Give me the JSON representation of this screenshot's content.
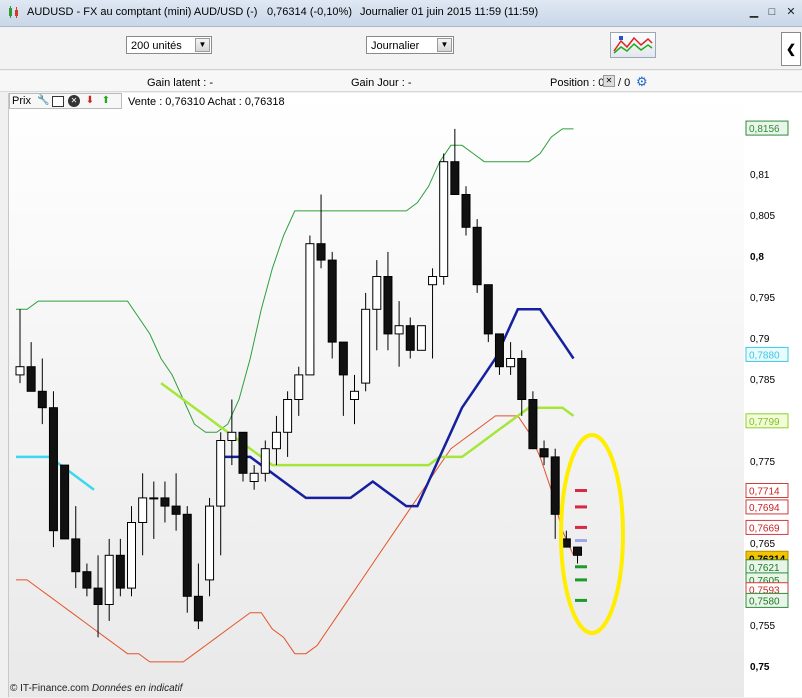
{
  "window": {
    "title": "AUDUSD - FX au comptant  (mini) AUD/USD (-)",
    "price_change": "0,76314 (-0,10%)",
    "period_info": "Journalier  01 juin 2015 11:59 (11:59)"
  },
  "toolbar": {
    "units_select": "200 unités",
    "period_select": "Journalier"
  },
  "infobar": {
    "gain_latent": "Gain latent : -",
    "gain_jour": "Gain Jour : -",
    "position_label": "Position : 0",
    "position_value": "/ 0"
  },
  "chart_toolbar": {
    "label": "Prix",
    "icons": [
      "wrench-icon",
      "window-icon",
      "close-icon",
      "down-arrow-icon",
      "up-arrow-icon"
    ]
  },
  "quote": "Vente : 0,76310 Achat : 0,76318",
  "footer": {
    "brand": "© IT-Finance.com",
    "note": "Données en indicatif"
  },
  "colors": {
    "upper_band": "#2e9e3e",
    "lower_band": "#e4532a",
    "ma_cyan": "#3bd8ee",
    "ma_navy": "#14209e",
    "ma_green": "#1d9e2a",
    "ma_lime": "#a6e63a",
    "highlight": "#ffee00",
    "last_price": "#f5c400"
  },
  "chart_data": {
    "type": "candlestick",
    "instrument": "AUDUSD",
    "y_ticks": [
      "0,81",
      "0,805",
      "0,8",
      "0,795",
      "0,79",
      "0,785",
      "0,775",
      "0,765",
      "0,755",
      "0,75"
    ],
    "ylim": [
      0.75,
      0.817
    ],
    "candles": [
      {
        "o": 0.7855,
        "h": 0.7935,
        "l": 0.7845,
        "c": 0.7865
      },
      {
        "o": 0.7865,
        "h": 0.7895,
        "l": 0.7835,
        "c": 0.7835
      },
      {
        "o": 0.7835,
        "h": 0.7875,
        "l": 0.7795,
        "c": 0.7815
      },
      {
        "o": 0.7815,
        "h": 0.7835,
        "l": 0.7645,
        "c": 0.7665
      },
      {
        "o": 0.7745,
        "h": 0.7745,
        "l": 0.7655,
        "c": 0.7655
      },
      {
        "o": 0.7655,
        "h": 0.7695,
        "l": 0.7595,
        "c": 0.7615
      },
      {
        "o": 0.7615,
        "h": 0.7625,
        "l": 0.7585,
        "c": 0.7595
      },
      {
        "o": 0.7595,
        "h": 0.7635,
        "l": 0.7535,
        "c": 0.7575
      },
      {
        "o": 0.7575,
        "h": 0.7655,
        "l": 0.7555,
        "c": 0.7635
      },
      {
        "o": 0.7635,
        "h": 0.7655,
        "l": 0.7585,
        "c": 0.7595
      },
      {
        "o": 0.7595,
        "h": 0.7695,
        "l": 0.7585,
        "c": 0.7675
      },
      {
        "o": 0.7675,
        "h": 0.7735,
        "l": 0.7635,
        "c": 0.7705
      },
      {
        "o": 0.7705,
        "h": 0.7725,
        "l": 0.7655,
        "c": 0.7705
      },
      {
        "o": 0.7705,
        "h": 0.7725,
        "l": 0.7675,
        "c": 0.7695
      },
      {
        "o": 0.7695,
        "h": 0.7735,
        "l": 0.7665,
        "c": 0.7685
      },
      {
        "o": 0.7685,
        "h": 0.7695,
        "l": 0.7565,
        "c": 0.7585
      },
      {
        "o": 0.7585,
        "h": 0.7625,
        "l": 0.7545,
        "c": 0.7555
      },
      {
        "o": 0.7605,
        "h": 0.7705,
        "l": 0.7585,
        "c": 0.7695
      },
      {
        "o": 0.7695,
        "h": 0.7785,
        "l": 0.7635,
        "c": 0.7775
      },
      {
        "o": 0.7775,
        "h": 0.7825,
        "l": 0.7745,
        "c": 0.7785
      },
      {
        "o": 0.7785,
        "h": 0.7785,
        "l": 0.7725,
        "c": 0.7735
      },
      {
        "o": 0.7725,
        "h": 0.7745,
        "l": 0.7715,
        "c": 0.7735
      },
      {
        "o": 0.7735,
        "h": 0.7775,
        "l": 0.7725,
        "c": 0.7765
      },
      {
        "o": 0.7765,
        "h": 0.7805,
        "l": 0.7745,
        "c": 0.7785
      },
      {
        "o": 0.7785,
        "h": 0.7835,
        "l": 0.7755,
        "c": 0.7825
      },
      {
        "o": 0.7825,
        "h": 0.7865,
        "l": 0.7805,
        "c": 0.7855
      },
      {
        "o": 0.7855,
        "h": 0.8025,
        "l": 0.7855,
        "c": 0.8015
      },
      {
        "o": 0.8015,
        "h": 0.8075,
        "l": 0.7985,
        "c": 0.7995
      },
      {
        "o": 0.7995,
        "h": 0.8005,
        "l": 0.7875,
        "c": 0.7895
      },
      {
        "o": 0.7895,
        "h": 0.7895,
        "l": 0.7805,
        "c": 0.7855
      },
      {
        "o": 0.7825,
        "h": 0.7855,
        "l": 0.7795,
        "c": 0.7835
      },
      {
        "o": 0.7845,
        "h": 0.7955,
        "l": 0.7835,
        "c": 0.7935
      },
      {
        "o": 0.7935,
        "h": 0.7995,
        "l": 0.7885,
        "c": 0.7975
      },
      {
        "o": 0.7975,
        "h": 0.8005,
        "l": 0.7885,
        "c": 0.7905
      },
      {
        "o": 0.7905,
        "h": 0.7945,
        "l": 0.7865,
        "c": 0.7915
      },
      {
        "o": 0.7915,
        "h": 0.7925,
        "l": 0.7875,
        "c": 0.7885
      },
      {
        "o": 0.7885,
        "h": 0.7915,
        "l": 0.7885,
        "c": 0.7915
      },
      {
        "o": 0.7965,
        "h": 0.7985,
        "l": 0.7875,
        "c": 0.7975
      },
      {
        "o": 0.7975,
        "h": 0.8125,
        "l": 0.7965,
        "c": 0.8115
      },
      {
        "o": 0.8115,
        "h": 0.8155,
        "l": 0.8075,
        "c": 0.8075
      },
      {
        "o": 0.8075,
        "h": 0.8085,
        "l": 0.8025,
        "c": 0.8035
      },
      {
        "o": 0.8035,
        "h": 0.8045,
        "l": 0.7955,
        "c": 0.7965
      },
      {
        "o": 0.7965,
        "h": 0.7965,
        "l": 0.7895,
        "c": 0.7905
      },
      {
        "o": 0.7905,
        "h": 0.7905,
        "l": 0.7855,
        "c": 0.7865
      },
      {
        "o": 0.7865,
        "h": 0.7895,
        "l": 0.7855,
        "c": 0.7875
      },
      {
        "o": 0.7875,
        "h": 0.7885,
        "l": 0.7805,
        "c": 0.7825
      },
      {
        "o": 0.7825,
        "h": 0.7835,
        "l": 0.7765,
        "c": 0.7765
      },
      {
        "o": 0.7765,
        "h": 0.7775,
        "l": 0.7745,
        "c": 0.7755
      },
      {
        "o": 0.7755,
        "h": 0.7765,
        "l": 0.7655,
        "c": 0.7685
      },
      {
        "o": 0.7655,
        "h": 0.7665,
        "l": 0.7645,
        "c": 0.7645
      },
      {
        "o": 0.7645,
        "h": 0.7645,
        "l": 0.7625,
        "c": 0.7635
      }
    ],
    "upper_band": [
      0.7935,
      0.7935,
      0.7945,
      0.7945,
      0.7945,
      0.7945,
      0.7945,
      0.7945,
      0.7945,
      0.7945,
      0.7945,
      0.7925,
      0.7905,
      0.7875,
      0.7855,
      0.7825,
      0.7795,
      0.7785,
      0.7785,
      0.7795,
      0.7825,
      0.7875,
      0.7935,
      0.7985,
      0.8025,
      0.8055,
      0.8055,
      0.8055,
      0.8055,
      0.8055,
      0.8055,
      0.8055,
      0.8055,
      0.8055,
      0.8055,
      0.8055,
      0.8065,
      0.8085,
      0.8115,
      0.8135,
      0.8135,
      0.8125,
      0.8115,
      0.8115,
      0.8115,
      0.8115,
      0.8115,
      0.8125,
      0.8145,
      0.8155,
      0.8155
    ],
    "lower_band": [
      0.7605,
      0.7605,
      0.7595,
      0.7585,
      0.7575,
      0.7565,
      0.7555,
      0.7545,
      0.7535,
      0.7525,
      0.7515,
      0.7515,
      0.7505,
      0.7505,
      0.7505,
      0.7505,
      0.7515,
      0.7525,
      0.7535,
      0.7545,
      0.7555,
      0.7565,
      0.7565,
      0.7545,
      0.7535,
      0.7515,
      0.7515,
      0.7525,
      0.7545,
      0.7565,
      0.7585,
      0.7605,
      0.7625,
      0.7645,
      0.7665,
      0.7685,
      0.7705,
      0.7725,
      0.7745,
      0.7765,
      0.7775,
      0.7785,
      0.7795,
      0.7805,
      0.7805,
      0.7805,
      0.7785,
      0.7755,
      0.7715,
      0.7665,
      0.7635
    ],
    "ma_fast": [
      0.7755,
      0.7755,
      0.7755,
      0.7755,
      0.7745,
      0.7735,
      0.7725,
      0.7715,
      0.7705,
      0.7705,
      0.7705,
      0.7705,
      0.7705,
      0.7715,
      0.7725,
      0.7715,
      0.7705,
      0.7695,
      0.7695,
      0.7725,
      0.7755,
      0.7785,
      0.7815,
      0.7835,
      0.7855,
      0.7875,
      0.7905,
      0.7935,
      0.7935,
      0.7935,
      0.7915,
      0.7895,
      0.7875
    ],
    "ma_slow": [
      0.7845,
      0.7835,
      0.7825,
      0.7815,
      0.7805,
      0.7795,
      0.7785,
      0.7775,
      0.7765,
      0.7755,
      0.7745,
      0.7745,
      0.7745,
      0.7745,
      0.7745,
      0.7745,
      0.7745,
      0.7745,
      0.7745,
      0.7745,
      0.7745,
      0.7745,
      0.7745,
      0.7745,
      0.7745,
      0.7755,
      0.7755,
      0.7755,
      0.7765,
      0.7775,
      0.7785,
      0.7795,
      0.7805,
      0.7815,
      0.7815,
      0.7815,
      0.7815,
      0.7805
    ],
    "right_labels": [
      {
        "text": "0,8156",
        "type": "upper"
      },
      {
        "text": "0,7880",
        "type": "fast"
      },
      {
        "text": "0,7799",
        "type": "slow"
      },
      {
        "text": "0,7714",
        "type": "red"
      },
      {
        "text": "0,7694",
        "type": "red"
      },
      {
        "text": "0,7669",
        "type": "red"
      },
      {
        "text": "0,76314",
        "type": "last"
      },
      {
        "text": "0,7621",
        "type": "green"
      },
      {
        "text": "0,7605",
        "type": "green"
      },
      {
        "text": "0,7593",
        "type": "red"
      },
      {
        "text": "0,7580",
        "type": "green"
      }
    ]
  }
}
